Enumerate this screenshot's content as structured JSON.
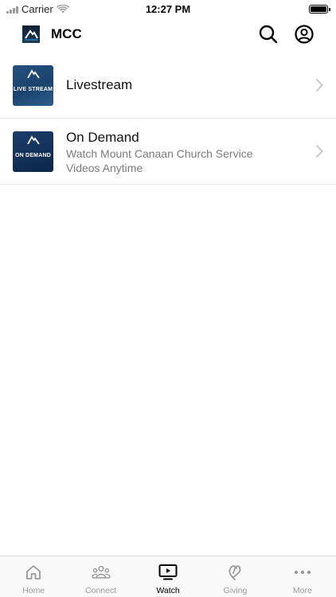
{
  "status_bar": {
    "carrier": "Carrier",
    "time": "12:27 PM"
  },
  "header": {
    "title": "MCC",
    "search_icon": "search-icon",
    "profile_icon": "user-circle-icon"
  },
  "list": [
    {
      "title": "Livestream",
      "thumb_label": "LIVE STREAM"
    },
    {
      "title": "On Demand",
      "subtitle": "Watch Mount Canaan Church Service Videos Anytime",
      "thumb_label": "ON DEMAND"
    }
  ],
  "tabs": [
    {
      "label": "Home",
      "icon": "home-icon"
    },
    {
      "label": "Connect",
      "icon": "people-icon"
    },
    {
      "label": "Watch",
      "icon": "tv-play-icon",
      "active": true
    },
    {
      "label": "Giving",
      "icon": "giving-icon"
    },
    {
      "label": "More",
      "icon": "more-dots-icon"
    }
  ],
  "colors": {
    "active_tab": "#000000",
    "inactive_tab": "#9a9a9a",
    "thumb_blue": "#1b3d6b"
  }
}
